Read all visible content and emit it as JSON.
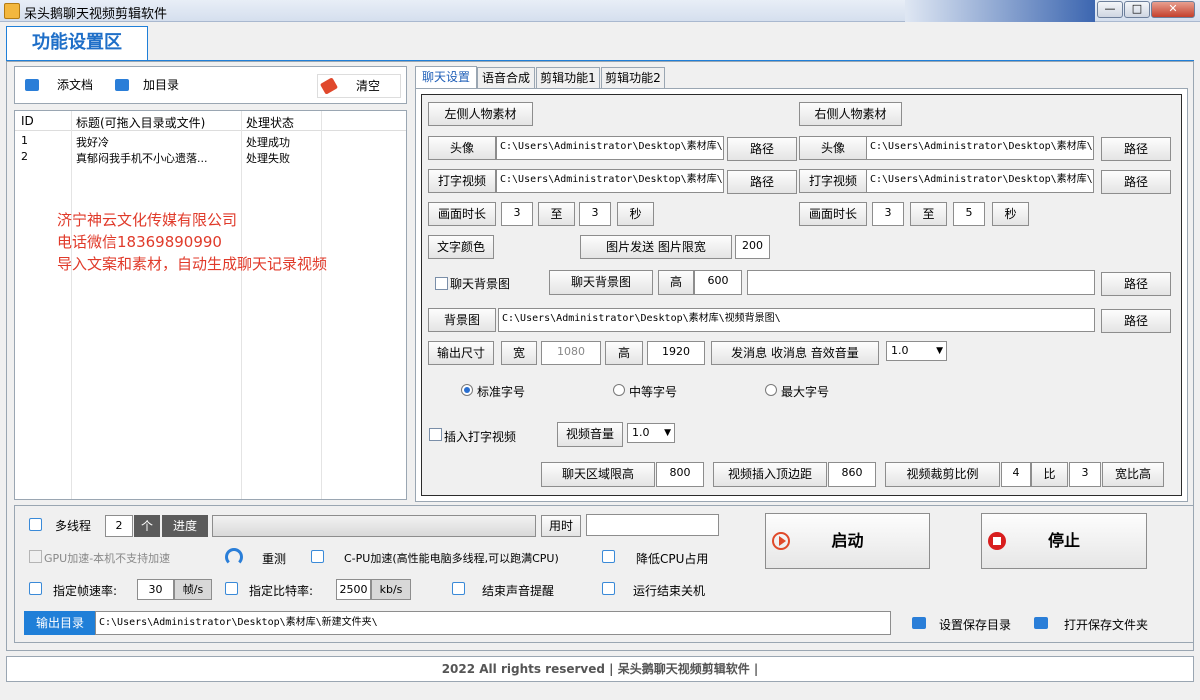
{
  "window": {
    "title": "呆头鹅聊天视频剪辑软件",
    "min": "—",
    "max": "□",
    "close": "✕"
  },
  "header": {
    "tab": "功能设置区"
  },
  "left": {
    "toolbar": {
      "add_doc": "添文档",
      "add_dir": "加目录",
      "clear": "清空"
    },
    "columns": [
      "ID",
      "标题(可拖入目录或文件)",
      "处理状态"
    ],
    "rows": [
      {
        "id": "1",
        "title": "我好冷",
        "status": "处理成功"
      },
      {
        "id": "2",
        "title": "真郁闷我手机不小心遗落...",
        "status": "处理失败"
      }
    ],
    "promo": [
      "济宁神云文化传媒有限公司",
      "电话微信18369890990",
      "导入文案和素材，自动生成聊天记录视频"
    ]
  },
  "tabs": [
    "聊天设置",
    "语音合成",
    "剪辑功能1",
    "剪辑功能2"
  ],
  "chat": {
    "left_material": "左侧人物素材",
    "right_material": "右侧人物素材",
    "avatar": "头像",
    "typing_video": "打字视频",
    "path": "路径",
    "left_avatar_path": "C:\\Users\\Administrator\\Desktop\\素材库\\",
    "left_typing_path": "C:\\Users\\Administrator\\Desktop\\素材库\\",
    "right_avatar_path": "C:\\Users\\Administrator\\Desktop\\素材库\\",
    "right_typing_path": "C:\\Users\\Administrator\\Desktop\\素材库\\",
    "duration": "画面时长",
    "to": "至",
    "sec": "秒",
    "left_dur_from": "3",
    "left_dur_to": "3",
    "right_dur_from": "3",
    "right_dur_to": "5",
    "text_color": "文字颜色",
    "image_send": "图片发送 图片限宽",
    "image_width": "200",
    "chat_bg_check": "聊天背景图",
    "chat_bg": "聊天背景图",
    "height": "高",
    "chat_bg_height": "600",
    "chat_bg_path": "",
    "background": "背景图",
    "bg_path": "C:\\Users\\Administrator\\Desktop\\素材库\\视频背景图\\",
    "output_size": "输出尺寸",
    "width": "宽",
    "out_width": "1080",
    "out_height": "1920",
    "sound_volume": "发消息 收消息 音效音量",
    "sound_volume_value": "1.0",
    "font_std": "标准字号",
    "font_mid": "中等字号",
    "font_max": "最大字号",
    "insert_typing": "插入打字视频",
    "video_volume": "视频音量",
    "video_volume_value": "1.0",
    "chat_area_height": "聊天区域限高",
    "chat_area_height_value": "800",
    "video_top_margin": "视频插入顶边距",
    "video_top_margin_value": "860",
    "crop_ratio": "视频裁剪比例",
    "ratio_a": "4",
    "ratio_word": "比",
    "ratio_b": "3",
    "ratio_suffix": "宽比高"
  },
  "bottom": {
    "multithread": "多线程",
    "threads": "2",
    "unit_ge": "个",
    "progress": "进度",
    "elapsed": "用时",
    "elapsed_value": "",
    "start": "启动",
    "stop": "停止",
    "gpu": "GPU加速-本机不支持加速",
    "retest": "重测",
    "cpu": "C-PU加速(高性能电脑多线程,可以跑满CPU)",
    "low_cpu": "降低CPU占用",
    "fps_label": "指定帧速率:",
    "fps": "30",
    "fps_unit": "帧/s",
    "bitrate_label": "指定比特率:",
    "bitrate": "2500",
    "bitrate_unit": "kb/s",
    "end_sound": "结束声音提醒",
    "shutdown": "运行结束关机",
    "output_dir_label": "输出目录",
    "output_dir": "C:\\Users\\Administrator\\Desktop\\素材库\\新建文件夹\\",
    "set_save_dir": "设置保存目录",
    "open_save_dir": "打开保存文件夹"
  },
  "footer": "2022 All rights reserved | 呆头鹅聊天视频剪辑软件 |",
  "colors": {
    "accent": "#1f7fd8",
    "promo": "#e03a2a",
    "start_icon": "#e04a2a",
    "stop_icon": "#d81e1e"
  }
}
